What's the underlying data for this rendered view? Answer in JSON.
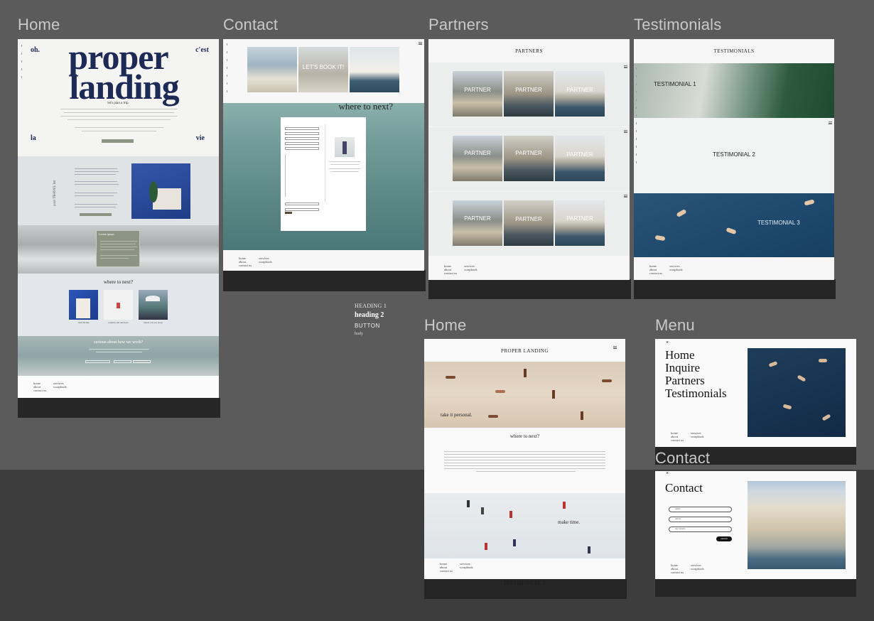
{
  "labels": {
    "home": "Home",
    "contact": "Contact",
    "partners": "Partners",
    "testimonials": "Testimonials",
    "home2": "Home",
    "menu": "Menu",
    "contact2": "Contact"
  },
  "home_frame": {
    "oh": "oh.",
    "cest": "c'est",
    "title_line1": "proper",
    "title_line2": "landing",
    "la": "la",
    "vie": "vie",
    "tagline": "let's plan a trip.",
    "section_title": "where to next?",
    "vertical_label": "your TRAVEL list",
    "card_titles": [
      "visit Sicilia",
      "explore our services",
      "check out our story"
    ],
    "cta": "curious about how we work?",
    "callout_title": "Lorem ipsum"
  },
  "contact_frame": {
    "book_label": "LET'S BOOK IT!",
    "heading": "where to next?"
  },
  "partners_frame": {
    "title": "PARTNERS",
    "card_label": "PARTNER"
  },
  "testimonials_frame": {
    "title": "TESTIMONIALS",
    "t1": "TESTIMONIAL 1",
    "t2": "TESTIMONIAL 2",
    "t3": "TESTIMONIAL 3"
  },
  "styles": {
    "heading1": "HEADING 1",
    "heading2": "heading 2",
    "button": "BUTTON",
    "body": "body"
  },
  "home2_frame": {
    "title": "PROPER LANDING",
    "take_it": "take it personal.",
    "where": "where to next?",
    "make_time": "make time.",
    "ghost": "TESTIMONIAL 3"
  },
  "menu_frame": {
    "items": [
      "Home",
      "Inquire",
      "Partners",
      "Testimonials"
    ]
  },
  "contact2_frame": {
    "title": "Contact",
    "fields": [
      "name",
      "email",
      "my details"
    ],
    "submit": "submit"
  },
  "footer": {
    "home": "home",
    "services": "services",
    "about": "about",
    "scrapbook": "scrapbook",
    "contact": "contact us"
  },
  "colors": {
    "canvas": "#5b5b5b",
    "navy": "#1c2a55",
    "sage": "#8c9484",
    "dark": "#262626"
  }
}
